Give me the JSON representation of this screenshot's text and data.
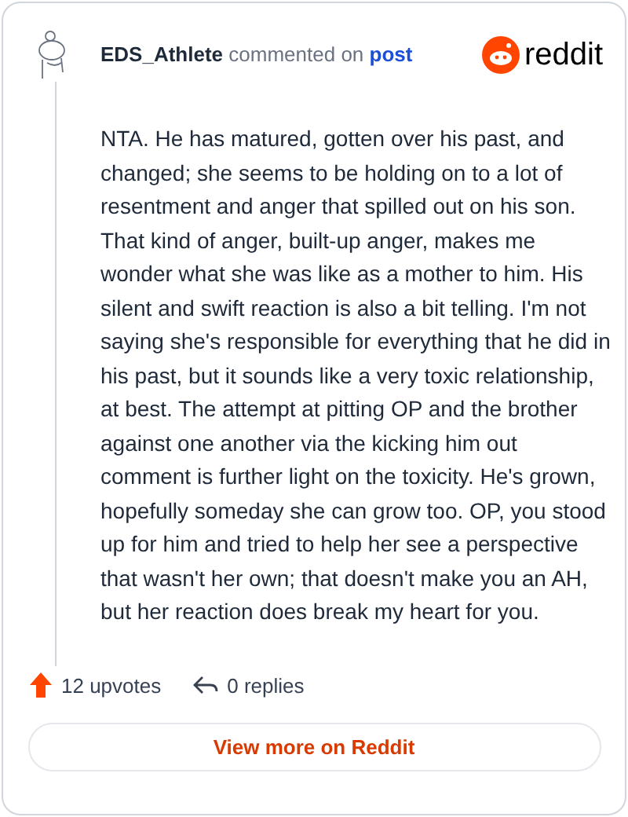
{
  "comment": {
    "author": "EDS_Athlete",
    "action": "commented on",
    "target": "post",
    "brand": "reddit",
    "body": "NTA. He has matured, gotten over his past, and changed; she seems to be holding on to a lot of resentment and anger that spilled out on his son. That kind of anger, built-up anger, makes me wonder what she was like as a mother to him. His silent and swift reaction is also a bit telling. I'm not saying she's responsible for everything that he did in his past, but it sounds like a very toxic relationship, at best. The attempt at pitting OP and the brother against one another via the kicking him out comment is further light on the toxicity. He's grown, hopefully someday she can grow too. OP, you stood up for him and tried to help her see a perspective that wasn't her own; that doesn't make you an AH, but her reaction does break my heart for you.",
    "upvotes": "12 upvotes",
    "replies": "0 replies"
  },
  "button": "View more on Reddit"
}
